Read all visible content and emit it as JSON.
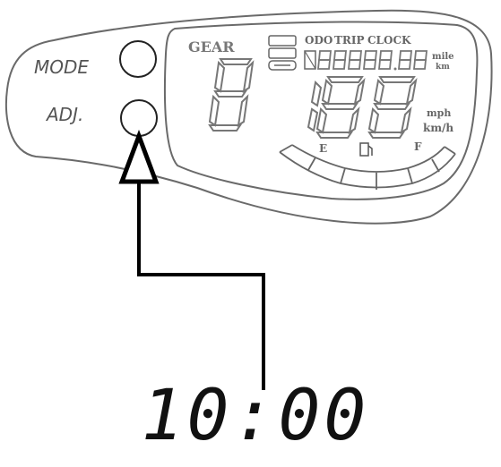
{
  "panel": {
    "mode_label": "MODE",
    "adj_label": "ADJ.",
    "gear_label": "GEAR",
    "odo_label": "ODO",
    "trip_label": "TRIP",
    "clock_label": "CLOCK",
    "mile_label": "mile",
    "km_label": "km",
    "mph_label": "mph",
    "kmh_label": "km/h",
    "fuel_empty_label": "E",
    "fuel_full_label": "F"
  },
  "clock_display": "10:00",
  "colors": {
    "outline": "#555555",
    "arrow": "#000000",
    "segments": "#777777"
  },
  "icons": [
    "fuel-pump-icon",
    "arrow-up-icon"
  ]
}
